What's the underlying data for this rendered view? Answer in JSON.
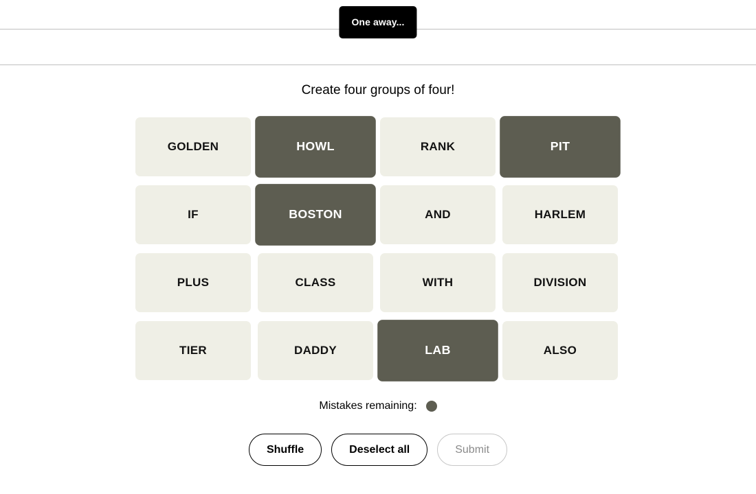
{
  "toast": {
    "message": "One away..."
  },
  "header": {
    "top_bar_label": "",
    "sub_bar_label": ""
  },
  "instruction": "Create four groups of four!",
  "board": {
    "tiles": [
      {
        "label": "GOLDEN",
        "selected": false
      },
      {
        "label": "HOWL",
        "selected": true
      },
      {
        "label": "RANK",
        "selected": false
      },
      {
        "label": "PIT",
        "selected": true
      },
      {
        "label": "IF",
        "selected": false
      },
      {
        "label": "BOSTON",
        "selected": true
      },
      {
        "label": "AND",
        "selected": false
      },
      {
        "label": "HARLEM",
        "selected": false
      },
      {
        "label": "PLUS",
        "selected": false
      },
      {
        "label": "CLASS",
        "selected": false
      },
      {
        "label": "WITH",
        "selected": false
      },
      {
        "label": "DIVISION",
        "selected": false
      },
      {
        "label": "TIER",
        "selected": false
      },
      {
        "label": "DADDY",
        "selected": false
      },
      {
        "label": "LAB",
        "selected": true
      },
      {
        "label": "ALSO",
        "selected": false
      }
    ]
  },
  "mistakes": {
    "label": "Mistakes remaining:",
    "remaining": 1
  },
  "actions": {
    "shuffle_label": "Shuffle",
    "deselect_label": "Deselect all",
    "submit_label": "Submit",
    "submit_disabled": true
  },
  "colors": {
    "tile_unselected_bg": "#efefe6",
    "tile_selected_bg": "#5d5d51",
    "tile_unselected_text": "#121212",
    "tile_selected_text": "#ffffff",
    "toast_bg": "#000000",
    "toast_text": "#ffffff",
    "divider": "#bfbfbf",
    "disabled_text": "#8a8a8a",
    "disabled_border": "#c7c7c7"
  }
}
